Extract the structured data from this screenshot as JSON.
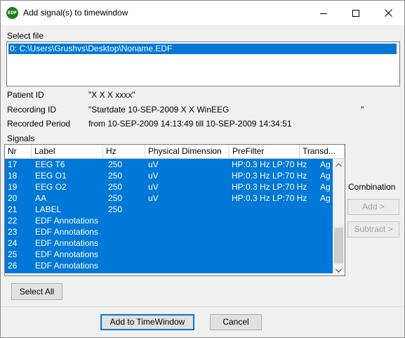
{
  "window": {
    "title": "Add signal(s) to timewindow",
    "icon": "edf-app-icon",
    "icon_text": "EDF"
  },
  "file_section": {
    "label": "Select file",
    "items": [
      "0: C:\\Users\\Grushvs\\Desktop\\Noname.EDF"
    ]
  },
  "info": {
    "patient_label": "Patient ID",
    "patient_value": "\"X X X xxxx\"",
    "recording_label": "Recording ID",
    "recording_value": "\"Startdate 10-SEP-2009 X X WinEEG",
    "recording_tail": "\"",
    "period_label": "Recorded Period",
    "period_value": "from 10-SEP-2009 14:13:49 till 10-SEP-2009 14:34:51"
  },
  "signals": {
    "label": "Signals",
    "columns": [
      "Nr",
      "Label",
      "Hz",
      "Physical Dimension",
      "PreFilter",
      "Transd..."
    ],
    "rows": [
      {
        "nr": "17",
        "label": "EEG T6",
        "hz": "250",
        "dim": "uV",
        "pre": "HP:0.3 Hz LP:70 Hz",
        "tr": "Ag"
      },
      {
        "nr": "18",
        "label": "EEG O1",
        "hz": "250",
        "dim": "uV",
        "pre": "HP:0.3 Hz LP:70 Hz",
        "tr": "Ag"
      },
      {
        "nr": "19",
        "label": "EEG O2",
        "hz": "250",
        "dim": "uV",
        "pre": "HP:0.3 Hz LP:70 Hz",
        "tr": "Ag"
      },
      {
        "nr": "20",
        "label": "AA",
        "hz": "250",
        "dim": "uV",
        "pre": "HP:0.3 Hz LP:70 Hz",
        "tr": "Ag"
      },
      {
        "nr": "21",
        "label": "LABEL",
        "hz": "250",
        "dim": "",
        "pre": "",
        "tr": ""
      },
      {
        "nr": "22",
        "label": "EDF Annotations",
        "hz": "",
        "dim": "",
        "pre": "",
        "tr": ""
      },
      {
        "nr": "23",
        "label": "EDF Annotations",
        "hz": "",
        "dim": "",
        "pre": "",
        "tr": ""
      },
      {
        "nr": "24",
        "label": "EDF Annotations",
        "hz": "",
        "dim": "",
        "pre": "",
        "tr": ""
      },
      {
        "nr": "25",
        "label": "EDF Annotations",
        "hz": "",
        "dim": "",
        "pre": "",
        "tr": ""
      },
      {
        "nr": "26",
        "label": "EDF Annotations",
        "hz": "",
        "dim": "",
        "pre": "",
        "tr": ""
      }
    ]
  },
  "combination": {
    "label": "Combination",
    "add": "Add >",
    "subtract": "Subtract >"
  },
  "buttons": {
    "select_all": "Select All",
    "add_to_timewindow": "Add to TimeWindow",
    "cancel": "Cancel"
  },
  "colors": {
    "selection": "#0078d7",
    "app_icon": "#1e7f1e"
  }
}
